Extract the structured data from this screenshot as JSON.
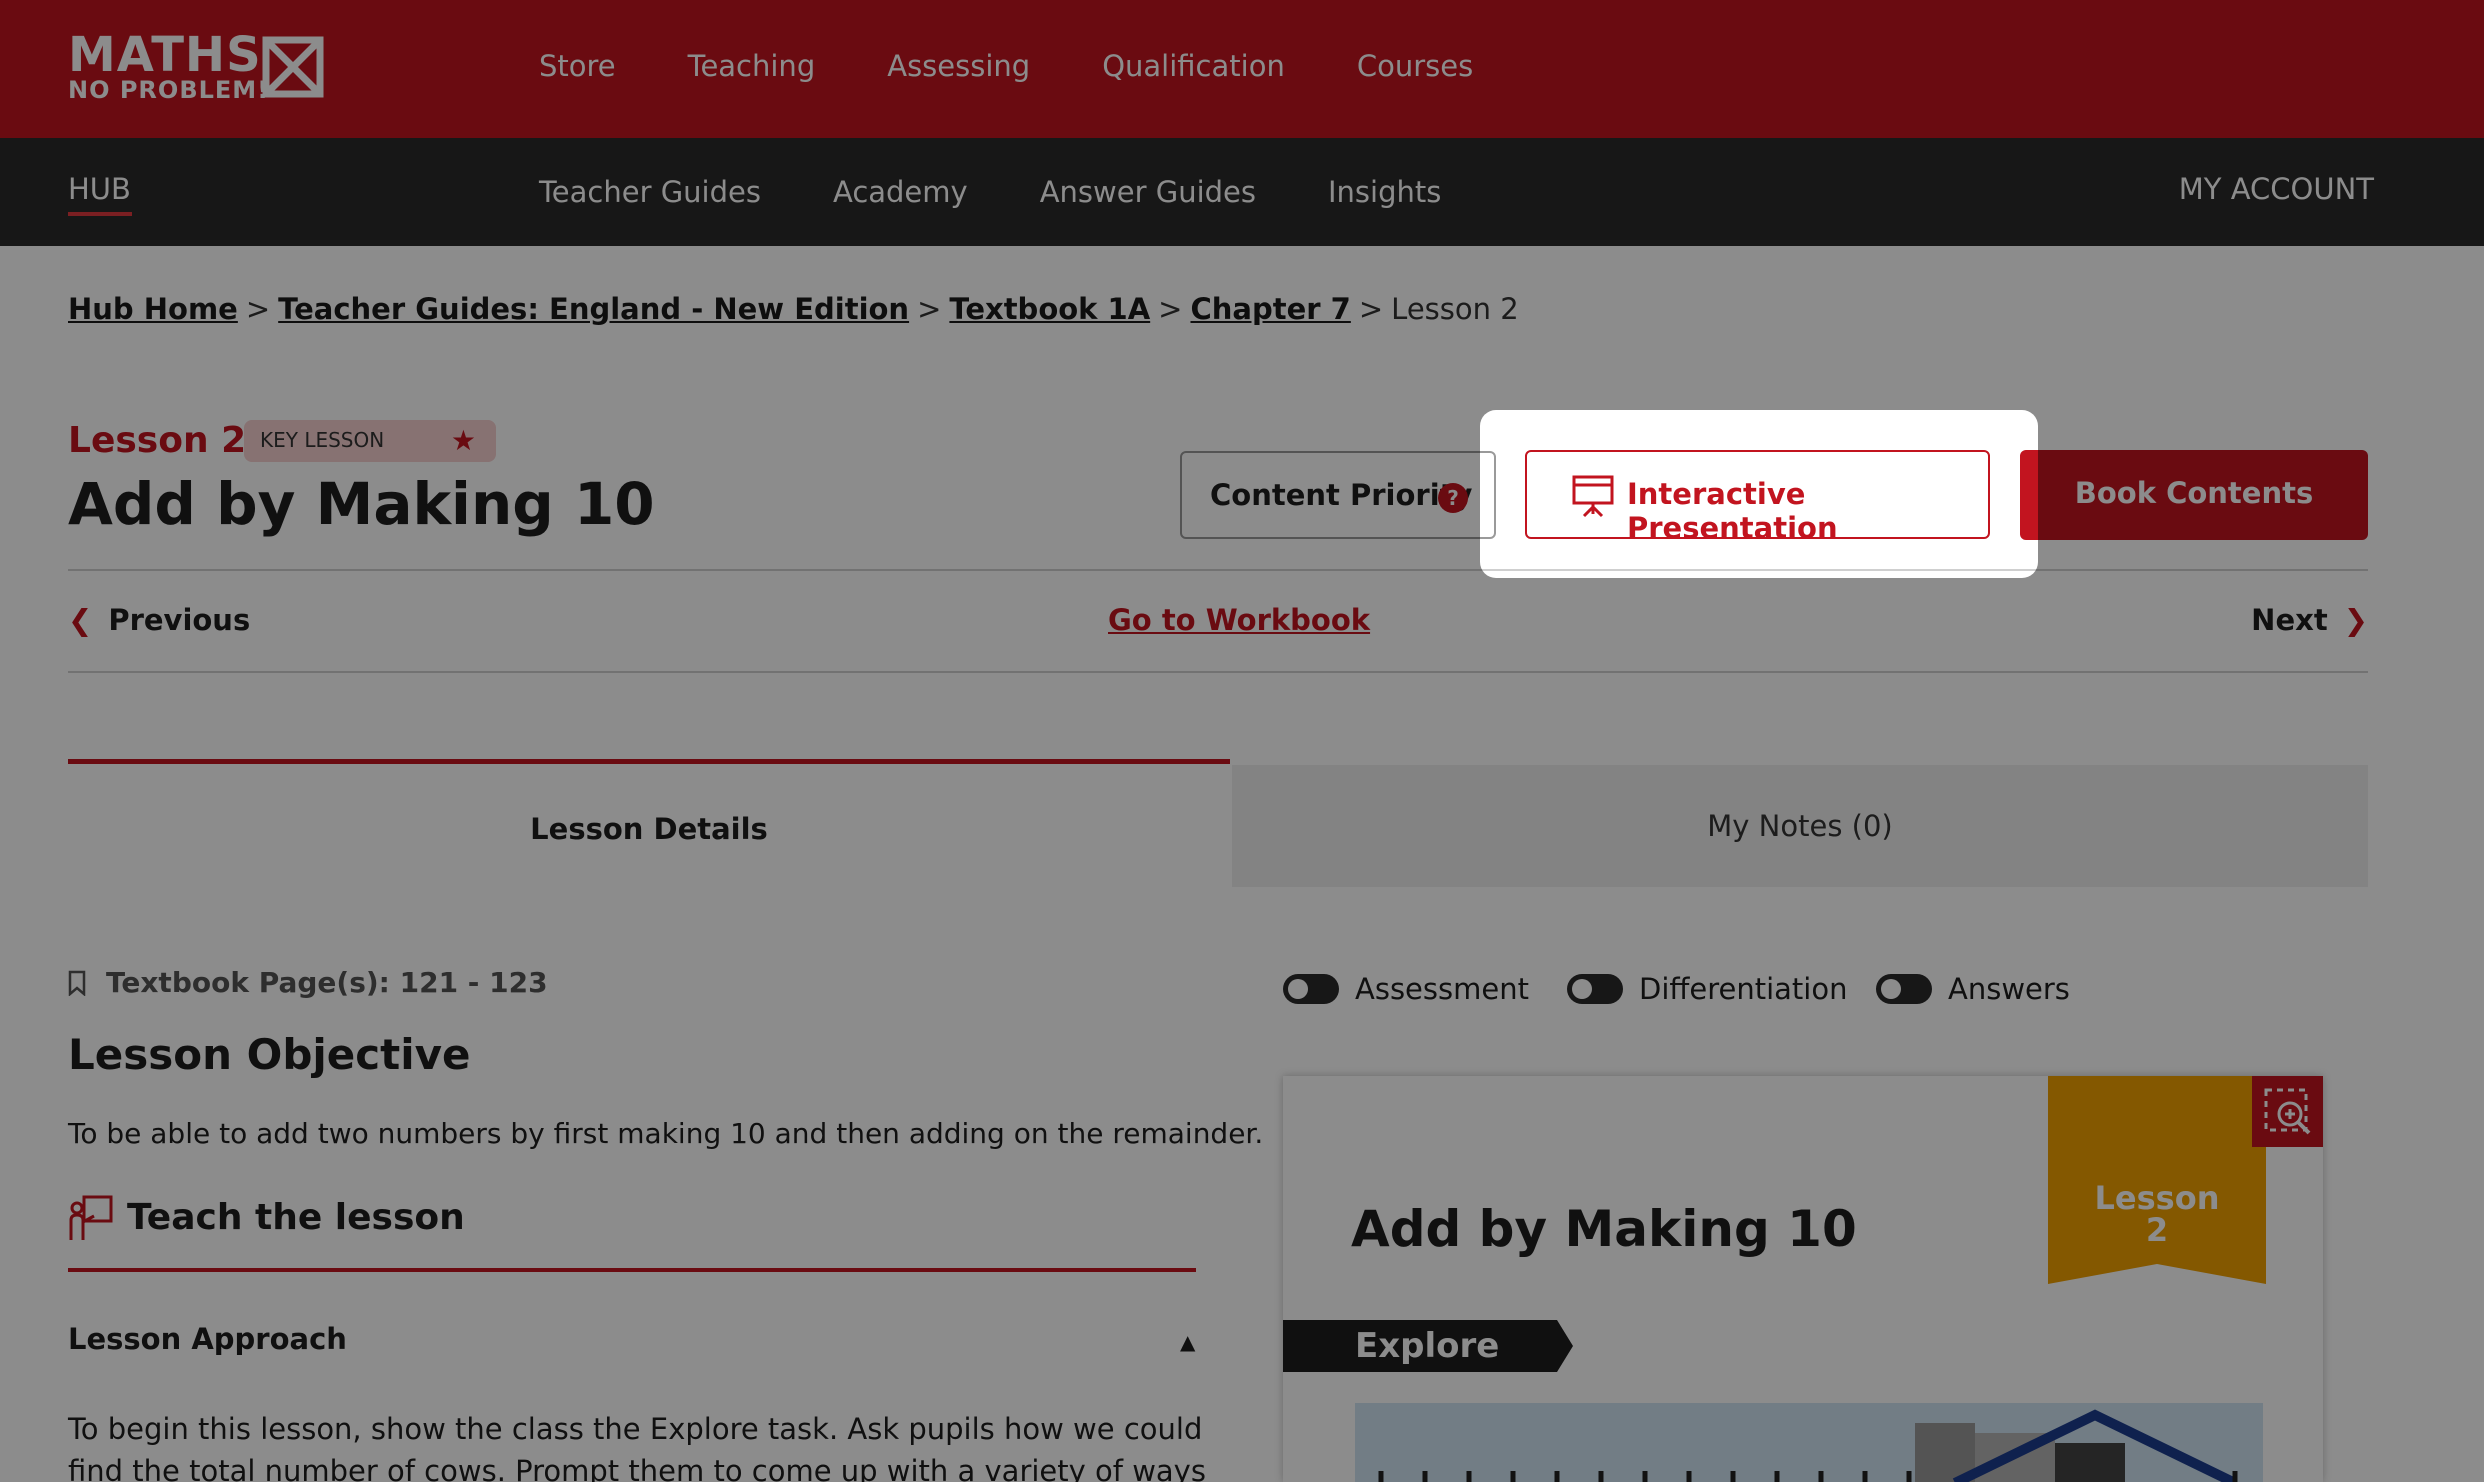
{
  "brand": {
    "line1": "MATHS",
    "line2": "NO PROBLEM!"
  },
  "top_nav": [
    "Store",
    "Teaching",
    "Assessing",
    "Qualification",
    "Courses"
  ],
  "sub_nav": {
    "hub": "HUB",
    "items": [
      "Teacher Guides",
      "Academy",
      "Answer Guides",
      "Insights"
    ],
    "account": "MY ACCOUNT"
  },
  "breadcrumb": {
    "items": [
      "Hub Home",
      "Teacher Guides: England - New Edition",
      "Textbook 1A",
      "Chapter 7"
    ],
    "current": "Lesson 2",
    "sep": ">"
  },
  "lesson": {
    "label": "Lesson 2",
    "badge": "KEY LESSON",
    "title": "Add by Making 10",
    "btn_priority": "Content Priority",
    "btn_interactive": "Interactive Presentation",
    "btn_book": "Book Contents",
    "prev": "Previous",
    "workbook": "Go to Workbook",
    "next": "Next"
  },
  "tabs": {
    "details": "Lesson Details",
    "notes": "My Notes (0)"
  },
  "content": {
    "pages": "Textbook Page(s): 121 - 123",
    "objective_heading": "Lesson Objective",
    "objective_text": "To be able to add two numbers by first making 10 and then adding on the remainder.",
    "teach_heading": "Teach the lesson",
    "approach": "Lesson Approach",
    "approach_text": "To begin this lesson, show the class the Explore task. Ask pupils how we could find the total number of cows. Prompt them to come up with a variety of ways and accept the"
  },
  "toggles": [
    "Assessment",
    "Differentiation",
    "Answers"
  ],
  "preview": {
    "title": "Add by Making 10",
    "ribbon_line1": "Lesson",
    "ribbon_line2": "2",
    "section": "Explore"
  },
  "colors": {
    "brand_red": "#c2141f",
    "dark_nav": "#2a2a2a",
    "ribbon": "#f0a000"
  }
}
